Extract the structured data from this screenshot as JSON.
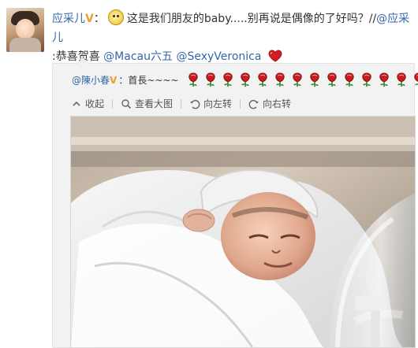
{
  "post": {
    "author": "应采儿",
    "verified_badge": "V",
    "text": "这是我们朋友的baby.....别再说是偶像的了好吗？//",
    "mention_1": "@应采儿",
    "text_2": ":恭喜贺喜",
    "mention_2": "@Macau六五",
    "mention_3": "@SexyVeronica",
    "emoji_face": "smile-icon",
    "emoji_heart": "heart-icon"
  },
  "repost": {
    "author": "@陳小春",
    "verified_badge": "V",
    "text": "：首長~~~~",
    "rose_icon": "rose-icon",
    "rose_count": 14,
    "toolbar": {
      "collapse_label": "收起",
      "view_large_label": "查看大图",
      "rotate_left_label": "向左转",
      "rotate_right_label": "向右转"
    },
    "photo_subject": "newborn-baby-photo"
  },
  "colors": {
    "link_blue": "#3366aa",
    "repost_bg": "#f2f2f2",
    "badge_gold": "#e7a12b",
    "rose_red": "#c71f1f"
  }
}
